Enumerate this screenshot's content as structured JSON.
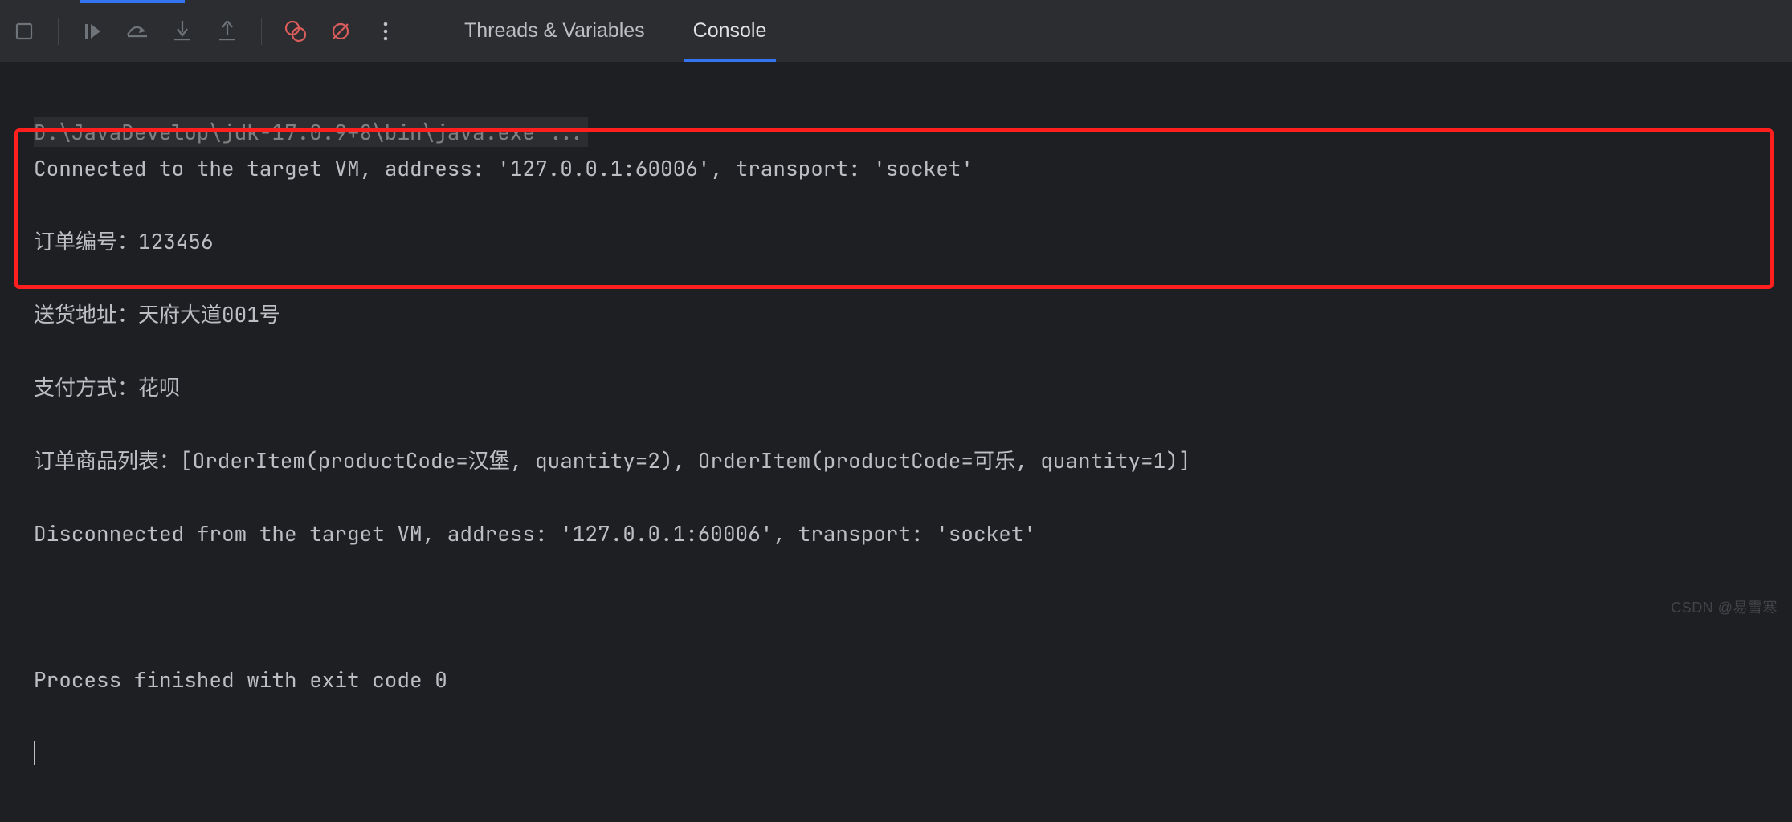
{
  "tabs": {
    "threads": "Threads & Variables",
    "console": "Console"
  },
  "console": {
    "cmd": "D:\\JavaDevelop\\jdk-17.0.9+8\\bin\\java.exe ...",
    "connected": "Connected to the target VM, address: '127.0.0.1:60006', transport: 'socket'",
    "order_no": "订单编号：123456",
    "delivery": "送货地址：天府大道001号",
    "payment": "支付方式：花呗",
    "items": "订单商品列表：[OrderItem(productCode=汉堡, quantity=2), OrderItem(productCode=可乐, quantity=1)]",
    "disconnected": "Disconnected from the target VM, address: '127.0.0.1:60006', transport: 'socket'",
    "exit": "Process finished with exit code 0"
  },
  "watermark": "CSDN @易雪寒"
}
